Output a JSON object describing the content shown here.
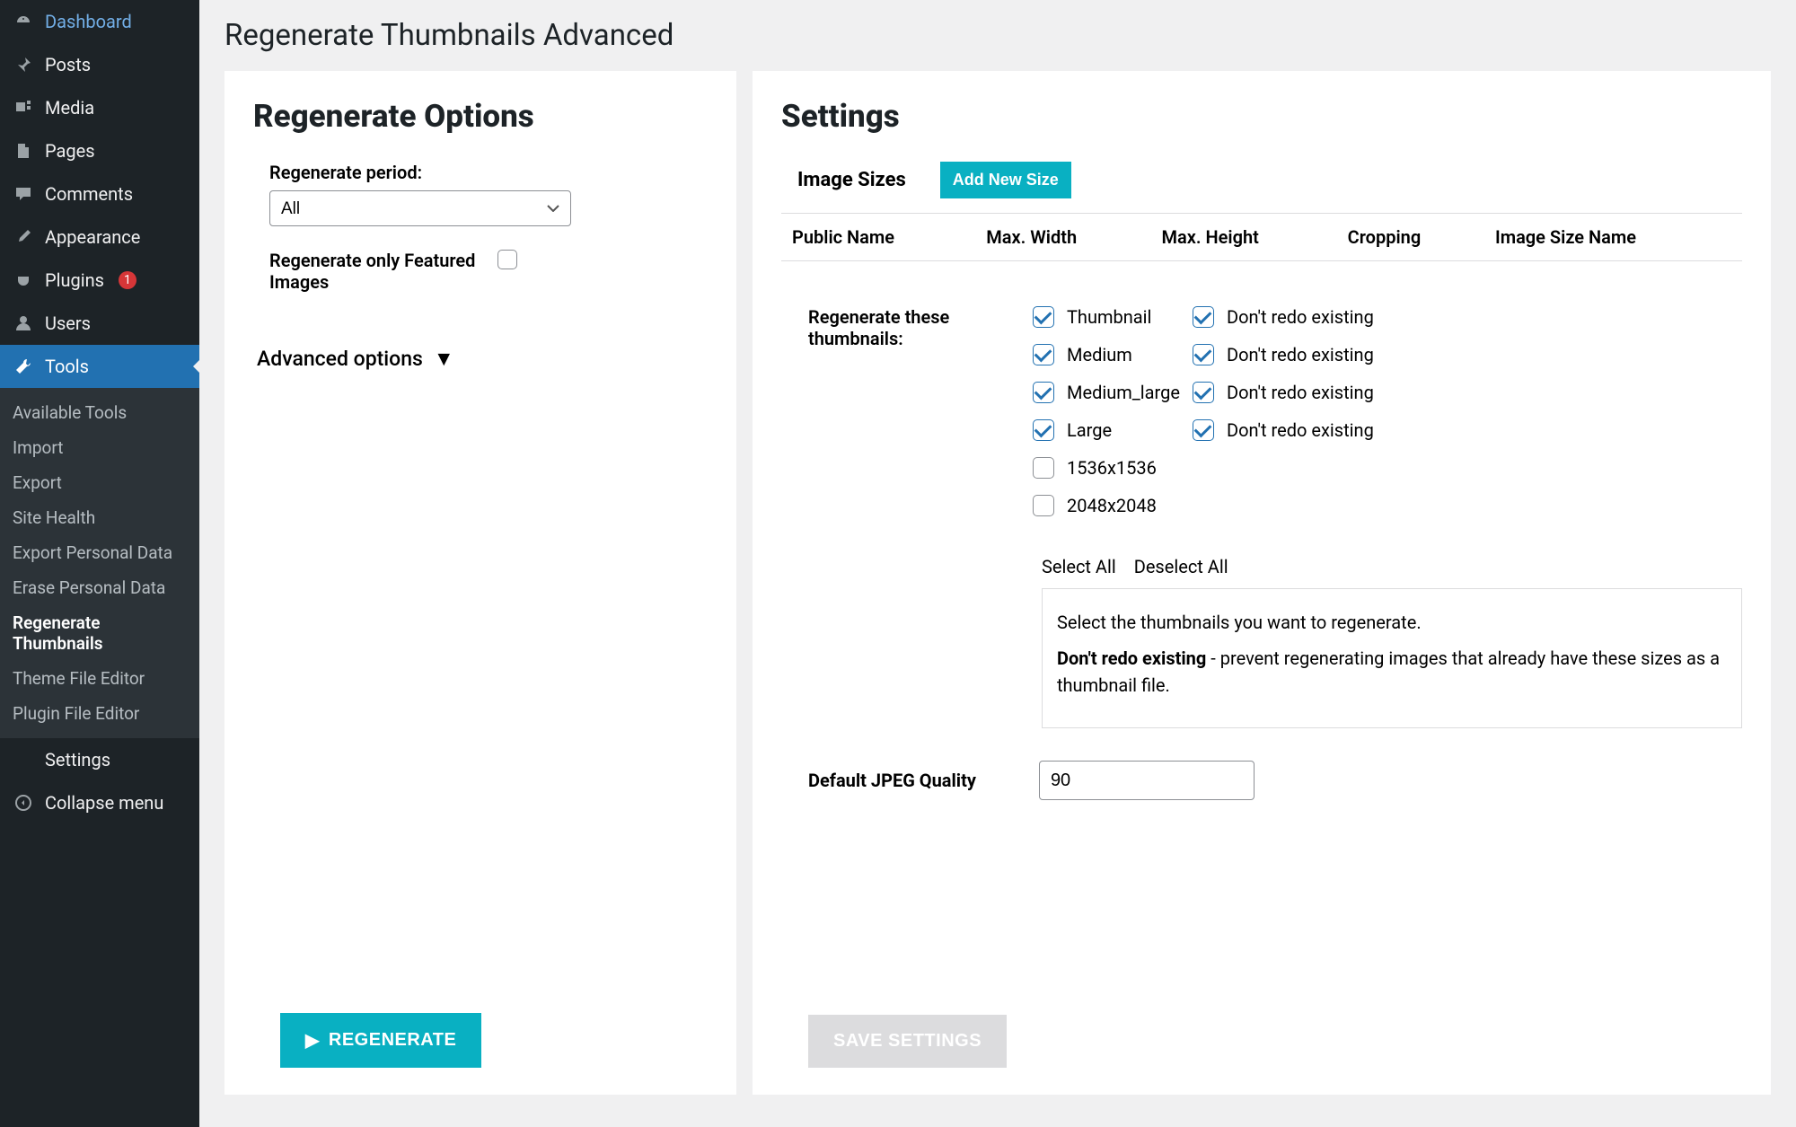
{
  "sidebar": {
    "items": [
      {
        "icon": "dashboard",
        "label": "Dashboard"
      },
      {
        "icon": "pin",
        "label": "Posts"
      },
      {
        "icon": "media",
        "label": "Media"
      },
      {
        "icon": "page",
        "label": "Pages"
      },
      {
        "icon": "comment",
        "label": "Comments"
      },
      {
        "icon": "appearance",
        "label": "Appearance"
      },
      {
        "icon": "plugin",
        "label": "Plugins",
        "badge": "1"
      },
      {
        "icon": "user",
        "label": "Users"
      },
      {
        "icon": "wrench",
        "label": "Tools",
        "active": true
      },
      {
        "icon": "settings",
        "label": "Settings"
      },
      {
        "icon": "collapse",
        "label": "Collapse menu"
      }
    ],
    "submenu": [
      {
        "label": "Available Tools"
      },
      {
        "label": "Import"
      },
      {
        "label": "Export"
      },
      {
        "label": "Site Health"
      },
      {
        "label": "Export Personal Data"
      },
      {
        "label": "Erase Personal Data"
      },
      {
        "label": "Regenerate Thumbnails",
        "current": true
      },
      {
        "label": "Theme File Editor"
      },
      {
        "label": "Plugin File Editor"
      }
    ]
  },
  "page": {
    "title": "Regenerate Thumbnails Advanced"
  },
  "regen_panel": {
    "title": "Regenerate Options",
    "period_label": "Regenerate period:",
    "period_value": "All",
    "featured_only_label": "Regenerate only Featured Images",
    "advanced_label": "Advanced options",
    "regenerate_button": "REGENERATE"
  },
  "settings_panel": {
    "title": "Settings",
    "image_sizes_title": "Image Sizes",
    "add_new_label": "Add New Size",
    "table_headers": [
      "Public Name",
      "Max. Width",
      "Max. Height",
      "Cropping",
      "Image Size Name"
    ],
    "regen_these_label": "Regenerate these thumbnails:",
    "thumbs": [
      {
        "name": "Thumbnail",
        "checked": true,
        "dont_redo": true
      },
      {
        "name": "Medium",
        "checked": true,
        "dont_redo": true
      },
      {
        "name": "Medium_large",
        "checked": true,
        "dont_redo": true
      },
      {
        "name": "Large",
        "checked": true,
        "dont_redo": true
      },
      {
        "name": "1536x1536",
        "checked": false,
        "dont_redo": null
      },
      {
        "name": "2048x2048",
        "checked": false,
        "dont_redo": null
      }
    ],
    "dont_redo_label": "Don't redo existing",
    "select_all": "Select All",
    "deselect_all": "Deselect All",
    "help_line1": "Select the thumbnails you want to regenerate.",
    "help_bold": "Don't redo existing",
    "help_line2": " - prevent regenerating images that already have these sizes as a thumbnail file.",
    "jpeg_label": "Default JPEG Quality",
    "jpeg_value": "90",
    "save_button": "SAVE SETTINGS"
  }
}
